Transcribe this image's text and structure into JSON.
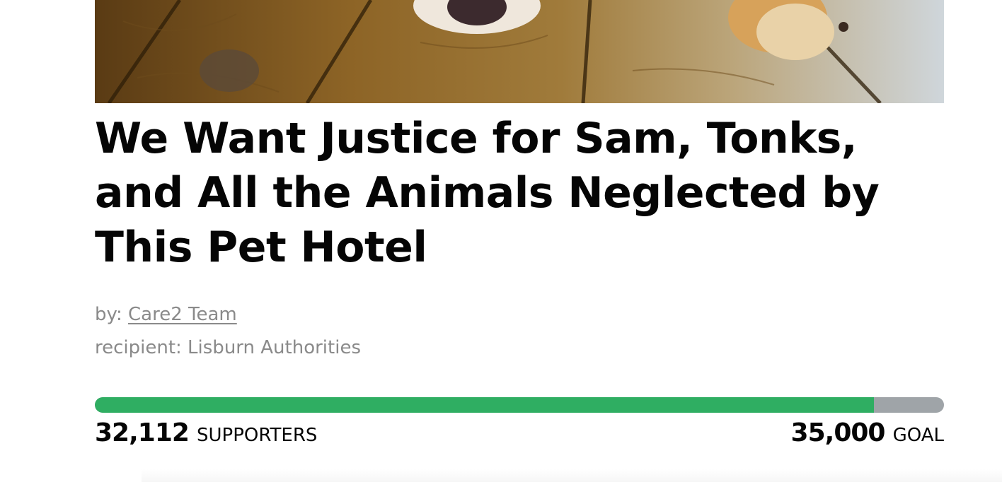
{
  "petition": {
    "title": "We Want Justice for Sam, Tonks, and All the Animals Neglected by This Pet Hotel",
    "by_prefix": "by:",
    "author": "Care2 Team",
    "recipient": "recipient: Lisburn Authorities"
  },
  "progress": {
    "supporters_count": "32,112",
    "supporters_label": "SUPPORTERS",
    "goal_count": "35,000",
    "goal_label": "GOAL",
    "fraction": 0.9175
  },
  "colors": {
    "progress_fill": "#2fae62",
    "progress_track": "#9fa4a8",
    "title_text": "#050505",
    "meta_text": "#8a8a8a"
  },
  "hero": {
    "icon": "dog-on-wood-floor-photo"
  }
}
